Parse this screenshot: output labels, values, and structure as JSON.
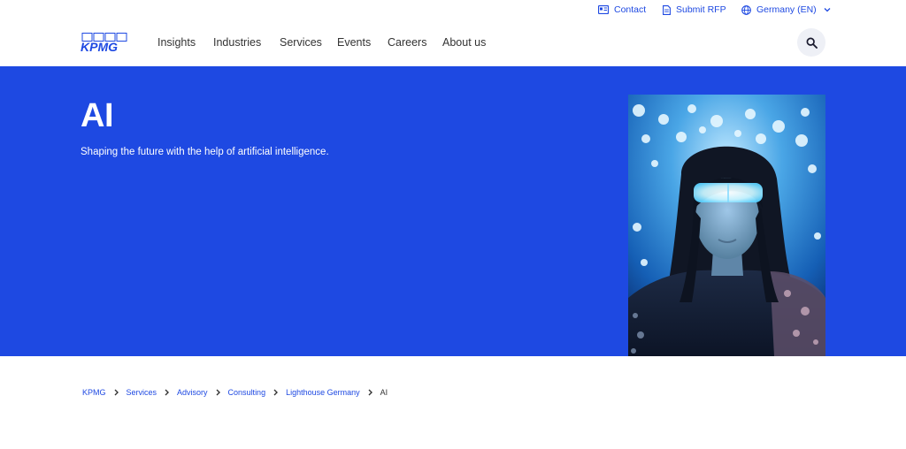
{
  "utility": {
    "contact_label": "Contact",
    "rfp_label": "Submit RFP",
    "language_label": "Germany (EN)"
  },
  "logo": {
    "text": "KPMG",
    "icon": "kpmg-logo"
  },
  "nav": {
    "items": [
      {
        "label": "Insights"
      },
      {
        "label": "Industries"
      },
      {
        "label": "Services"
      },
      {
        "label": "Events"
      },
      {
        "label": "Careers"
      },
      {
        "label": "About us"
      }
    ],
    "search_icon": "search-icon"
  },
  "hero": {
    "title": "AI",
    "subtitle": "Shaping the future with the help of artificial intelligence.",
    "image_alt": "woman-wearing-glowing-digital-glasses-photo"
  },
  "breadcrumb": {
    "items": [
      "KPMG",
      "Services",
      "Advisory",
      "Consulting",
      "Lighthouse Germany"
    ],
    "current": "AI"
  },
  "colors": {
    "brand_blue": "#1e49e2",
    "text_dark": "#333333",
    "search_bg": "#eef0f6"
  }
}
